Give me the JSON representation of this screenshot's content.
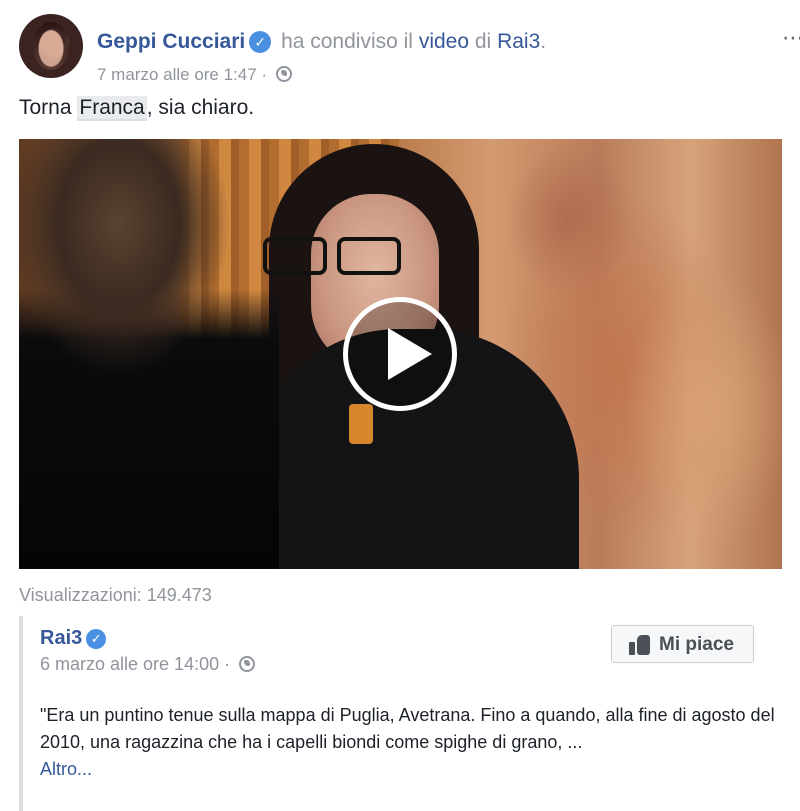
{
  "post": {
    "author": "Geppi Cucciari",
    "action_text": "ha condiviso il",
    "object_text": "video",
    "connector": "di",
    "source_page": "Rai3",
    "trailing": ".",
    "timestamp": "7 marzo alle ore 1:47 ·",
    "text_before": "Torna ",
    "mention": "Franca",
    "text_after": ", sia chiaro.",
    "more_icon": "⋯"
  },
  "video": {
    "views": "Visualizzazioni: 149.473"
  },
  "shared": {
    "page_name": "Rai3",
    "timestamp": "6 marzo alle ore 14:00 ·",
    "like_button_label": "Mi piace",
    "description": "\"Era un puntino tenue sulla mappa di Puglia, Avetrana. Fino a quando, alla fine di agosto del 2010, una ragazzina che ha i capelli biondi come spighe di grano, ...",
    "more_link": "Altro..."
  },
  "icons": {
    "verified": "verified-check-icon",
    "globe": "globe-public-icon",
    "play": "play-icon",
    "like": "thumbs-up-icon",
    "more": "more-options-icon"
  },
  "colors": {
    "link": "#365899",
    "muted": "#90949c",
    "verified": "#4a90e2",
    "text": "#1d2129"
  }
}
